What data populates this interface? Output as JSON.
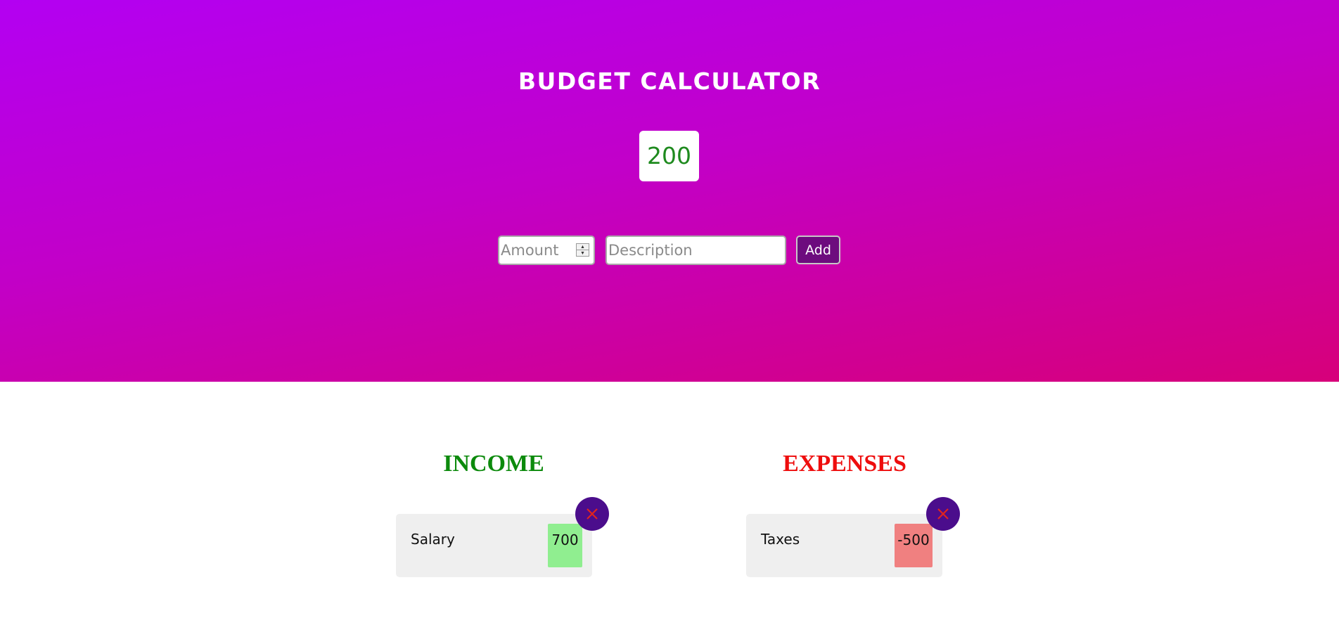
{
  "header": {
    "title": "BUDGET CALCULATOR"
  },
  "balance": {
    "value": "200",
    "color": "#1e8a1e"
  },
  "form": {
    "amount_placeholder": "Amount",
    "description_placeholder": "Description",
    "add_label": "Add"
  },
  "income": {
    "heading": "INCOME",
    "color": "#0c8a0c",
    "items": [
      {
        "label": "Salary",
        "value": "700",
        "color": "#90ee90"
      }
    ]
  },
  "expenses": {
    "heading": "EXPENSES",
    "color": "#ee0d0d",
    "items": [
      {
        "label": "Taxes",
        "value": "-500",
        "color": "#f08080"
      }
    ]
  },
  "icons": {
    "delete": "close-icon",
    "spinner_up": "triangle-up-icon",
    "spinner_down": "triangle-down-icon"
  },
  "colors": {
    "hero_top": "#b300f2",
    "hero_bottom": "#d7007a",
    "add_button": "#6d0c7e",
    "delete_button": "#4b0d8c",
    "delete_icon": "#e0241e",
    "item_background": "#efefef"
  }
}
